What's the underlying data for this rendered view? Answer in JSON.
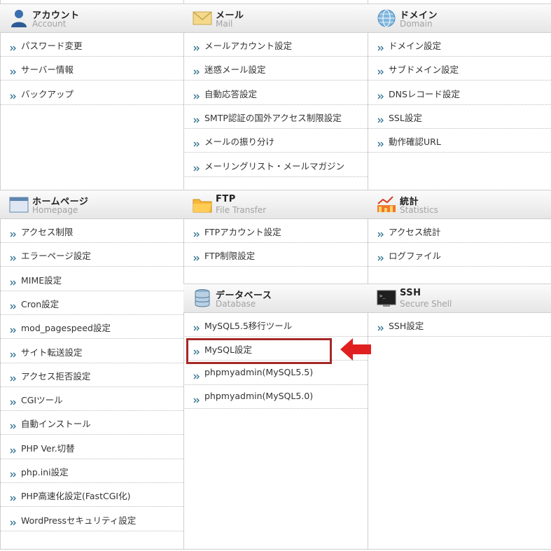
{
  "sections": {
    "account": {
      "title": "アカウント",
      "subtitle": "Account",
      "items": [
        "パスワード変更",
        "サーバー情報",
        "バックアップ"
      ]
    },
    "mail": {
      "title": "メール",
      "subtitle": "Mail",
      "items": [
        "メールアカウント設定",
        "迷惑メール設定",
        "自動応答設定",
        "SMTP認証の国外アクセス制限設定",
        "メールの振り分け",
        "メーリングリスト・メールマガジン"
      ]
    },
    "domain": {
      "title": "ドメイン",
      "subtitle": "Domain",
      "items": [
        "ドメイン設定",
        "サブドメイン設定",
        "DNSレコード設定",
        "SSL設定",
        "動作確認URL"
      ]
    },
    "homepage": {
      "title": "ホームページ",
      "subtitle": "Homepage",
      "items": [
        "アクセス制限",
        "エラーページ設定",
        "MIME設定",
        "Cron設定",
        "mod_pagespeed設定",
        "サイト転送設定",
        "アクセス拒否設定",
        "CGIツール",
        "自動インストール",
        "PHP Ver.切替",
        "php.ini設定",
        "PHP高速化設定(FastCGI化)",
        "WordPressセキュリティ設定"
      ]
    },
    "ftp": {
      "title": "FTP",
      "subtitle": "File Transfer",
      "items": [
        "FTPアカウント設定",
        "FTP制限設定"
      ]
    },
    "stats": {
      "title": "統計",
      "subtitle": "Statistics",
      "items": [
        "アクセス統計",
        "ログファイル"
      ]
    },
    "database": {
      "title": "データベース",
      "subtitle": "Database",
      "items": [
        "MySQL5.5移行ツール",
        "MySQL設定",
        "phpmyadmin(MySQL5.5)",
        "phpmyadmin(MySQL5.0)"
      ]
    },
    "ssh": {
      "title": "SSH",
      "subtitle": "Secure Shell",
      "items": [
        "SSH設定"
      ]
    }
  },
  "colors": {
    "highlight": "#a52828",
    "arrow": "#e02020",
    "link_arrow": "#2a6f8f"
  }
}
